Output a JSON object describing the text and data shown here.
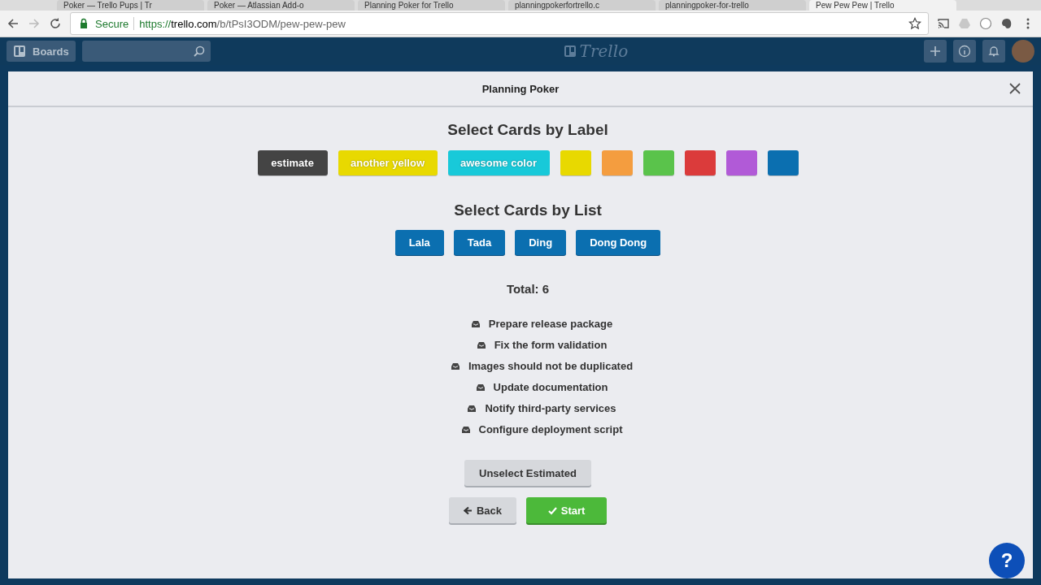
{
  "browser": {
    "tabs": [
      {
        "title": "Poker — Trello Pups | Tr",
        "selected": false
      },
      {
        "title": "Poker — Atlassian Add-o",
        "selected": false
      },
      {
        "title": "Planning Poker for Trello",
        "selected": false
      },
      {
        "title": "planningpokerfortrello.c",
        "selected": false
      },
      {
        "title": "planningpoker-for-trello",
        "selected": false
      },
      {
        "title": "Pew Pew Pew | Trello",
        "selected": true
      }
    ],
    "secure_label": "Secure",
    "url": {
      "scheme": "https://",
      "host": "trello.com",
      "path": "/b/tPsI3ODM/pew-pew-pew"
    }
  },
  "header": {
    "boards_button": "Boards",
    "logo": "Trello"
  },
  "dialog": {
    "title": "Planning Poker",
    "label_section": {
      "heading": "Select Cards by Label",
      "labels": [
        {
          "text": "estimate",
          "color": "#444444"
        },
        {
          "text": "another yellow",
          "color": "#e8d900"
        },
        {
          "text": "awesome color",
          "color": "#18c9d9"
        },
        {
          "color": "#e8d900"
        },
        {
          "color": "#f49d3f"
        },
        {
          "color": "#5ac34b"
        },
        {
          "color": "#db3b3b"
        },
        {
          "color": "#b15ad7"
        },
        {
          "color": "#0b6fb0"
        }
      ]
    },
    "list_section": {
      "heading": "Select Cards by List",
      "lists": [
        "Lala",
        "Tada",
        "Ding",
        "Dong Dong"
      ]
    },
    "total": "Total: 6",
    "cards": [
      "Prepare release package",
      "Fix the form validation",
      "Images should not be duplicated",
      "Update documentation",
      "Notify third-party services",
      "Configure deployment script"
    ],
    "buttons": [
      {
        "kind": "plain",
        "label": "Unselect Estimated"
      },
      {
        "kind": "back",
        "label": "Back"
      },
      {
        "kind": "start",
        "label": "Start"
      }
    ],
    "help_button": "?"
  }
}
